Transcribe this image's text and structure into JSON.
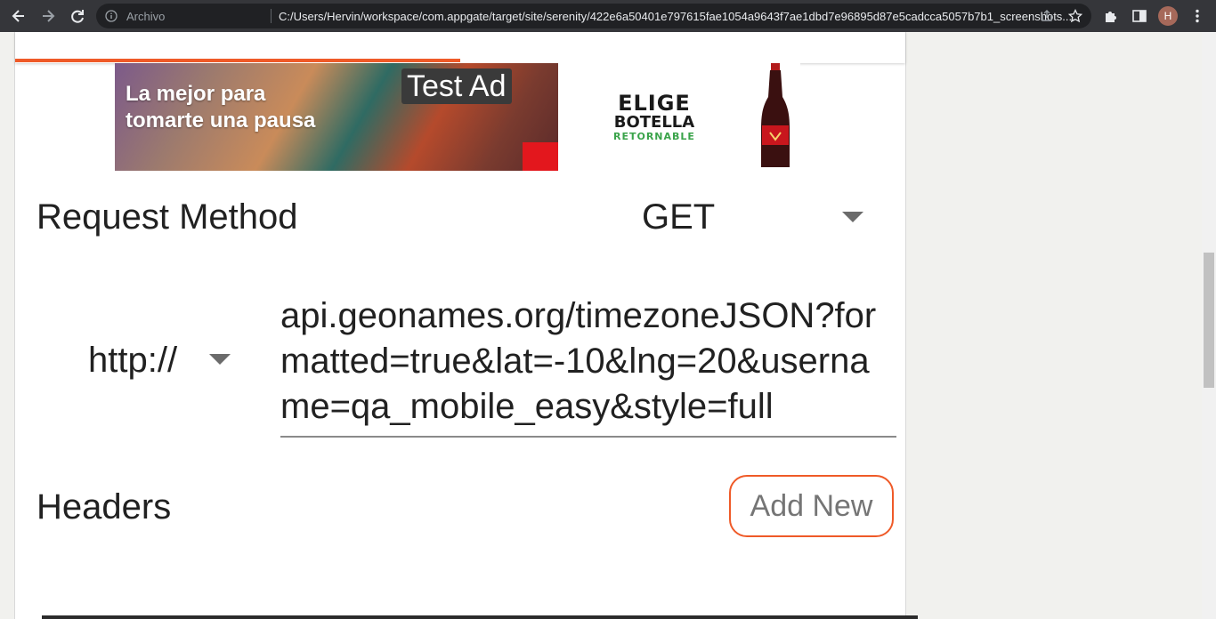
{
  "browser": {
    "scheme_label": "Archivo",
    "url": "C:/Users/Hervin/workspace/com.appgate/target/site/serenity/422e6a50401e797615fae1054a9643f7ae1dbd7e96895d87e5cadcca5057b7b1_screenshots....",
    "profile_initial": "H",
    "icons": [
      "back-arrow-icon",
      "forward-arrow-icon",
      "reload-icon",
      "info-icon",
      "share-icon",
      "star-icon",
      "puzzle-icon",
      "side-panel-icon",
      "kebab-menu-icon"
    ]
  },
  "ad": {
    "badge": "Test Ad",
    "slogan_line1": "La mejor para",
    "slogan_line2": "tomarte una pausa",
    "brand_line1": "ELIGE",
    "brand_line2": "BOTELLA",
    "brand_line3": "RETORNABLE"
  },
  "form": {
    "request_method_label": "Request Method",
    "request_method_value": "GET",
    "protocol_value": "http://",
    "url_value": "api.geonames.org/timezoneJSON?formatted=true&lat=-10&lng=20&username=qa_mobile_easy&style=full",
    "headers_label": "Headers",
    "add_new_label": "Add New"
  },
  "colors": {
    "accent": "#ef5a28",
    "chrome_bg": "#35363a",
    "omnibox_bg": "#202124"
  }
}
